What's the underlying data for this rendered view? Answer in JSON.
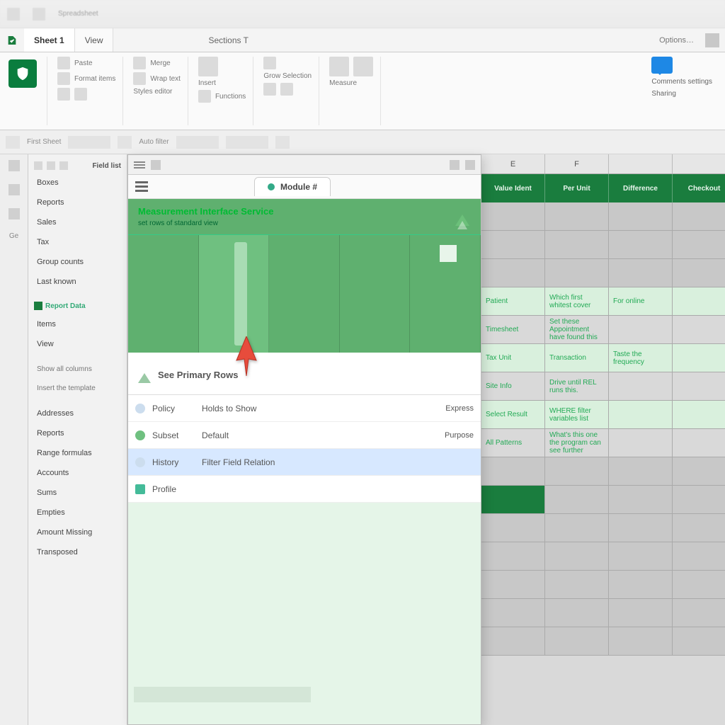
{
  "topstrip": {
    "label": "Spreadsheet"
  },
  "tabstrip": {
    "tab1": "Sheet 1",
    "tab2": "View",
    "center": "Sections T",
    "right": "Options…"
  },
  "ribbon": {
    "g1a": "Paste",
    "g1b": "Format items",
    "g2a": "Merge",
    "g2b": "Wrap text",
    "g2c": "Styles editor",
    "g3a": "Insert",
    "g3b": "Functions",
    "g4": "Grow Selection",
    "g5": "Measure",
    "rightTop": "Comments settings",
    "rightBot": "Sharing"
  },
  "ribbon2": {
    "a": "First Sheet",
    "b": "Auto filter"
  },
  "sidebar": {
    "hdr": "Field list",
    "items": [
      "Boxes",
      "Reports",
      "Sales",
      "Tax",
      "Group counts",
      "Last known"
    ],
    "mid": "Report Data",
    "items2": [
      "Items",
      "View"
    ],
    "low1": "Show all columns",
    "low2": "Insert the template",
    "items3": [
      "Addresses",
      "Reports",
      "Range formulas",
      "Accounts",
      "Sums",
      "Empties",
      "Amount Missing",
      "Transposed"
    ]
  },
  "panel": {
    "tab": "Module #",
    "banner_title": "Measurement Interface Service",
    "banner_sub": "set rows of standard view",
    "section": "See Primary Rows",
    "rows": [
      {
        "k": "Policy",
        "v": "Holds to Show",
        "r": "Express"
      },
      {
        "k": "Subset",
        "v": "Default",
        "r": "Purpose"
      },
      {
        "k": "History",
        "v": "Filter Field Relation",
        "r": ""
      },
      {
        "k": "Profile",
        "v": "",
        "r": ""
      }
    ]
  },
  "grid": {
    "cols": [
      "",
      "E",
      "F"
    ],
    "ghdrs": [
      "",
      "Value Ident",
      "Per Unit",
      "Difference",
      "Checkout"
    ],
    "rows": [
      {
        "a": "",
        "b": "Patient",
        "c": "Which first whitest cover",
        "d": "For online"
      },
      {
        "a": "",
        "b": "Timesheet",
        "c": "Set these Appointment have found this",
        "d": ""
      },
      {
        "a": "",
        "b": "Tax Unit",
        "c": "Transaction",
        "d": "Taste the frequency"
      },
      {
        "a": "",
        "b": "Site Info",
        "c": "Drive until REL runs this.",
        "d": ""
      },
      {
        "a": "",
        "b": "Select Result",
        "c": "WHERE filter variables list",
        "d": ""
      },
      {
        "a": "",
        "b": "All Patterns",
        "c": "What's this one the program can see further",
        "d": ""
      }
    ]
  }
}
